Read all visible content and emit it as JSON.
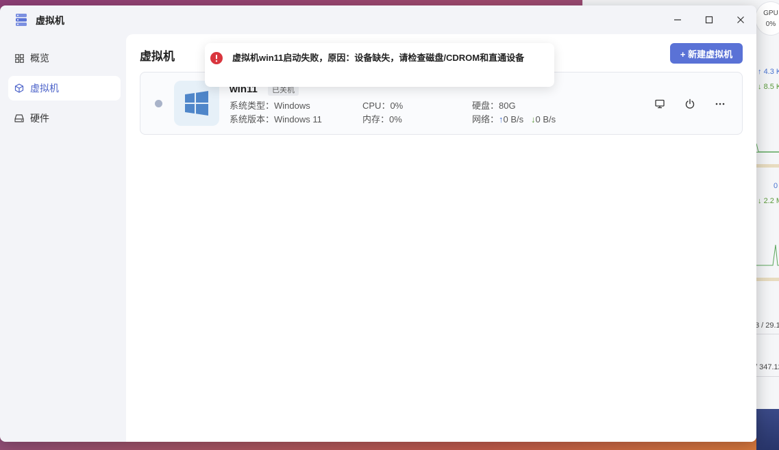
{
  "background_widget": {
    "gpu_label": "GPU",
    "gpu_value": "0%",
    "up_rate": "4.3 K",
    "down_rate": "8.5 K",
    "value_0": "0",
    "rate_2": "2.2 M",
    "mem_partial": "3 / 29.1",
    "disk_partial": "/ 347.12"
  },
  "window": {
    "title": "虚拟机",
    "controls": {
      "minimize": "minimize",
      "maximize": "maximize",
      "close": "close"
    }
  },
  "sidebar": {
    "items": [
      {
        "label": "概览",
        "icon": "grid-icon",
        "active": false
      },
      {
        "label": "虚拟机",
        "icon": "cube-icon",
        "active": true
      },
      {
        "label": "硬件",
        "icon": "drive-icon",
        "active": false
      }
    ]
  },
  "main": {
    "title": "虚拟机",
    "new_button": "+ 新建虚拟机"
  },
  "vm": {
    "name": "win11",
    "state": "已关机",
    "os_type_label": "系统类型：",
    "os_type": "Windows",
    "os_version_label": "系统版本：",
    "os_version": "Windows 11",
    "cpu_label": "CPU：",
    "cpu": "0%",
    "mem_label": "内存：",
    "mem": "0%",
    "disk_label": "硬盘：",
    "disk": "80G",
    "net_label": "网络：",
    "net_up": "0 B/s",
    "net_down": "0 B/s",
    "up_arrow": "↑",
    "down_arrow": "↓"
  },
  "toast": {
    "type": "error",
    "message": "虚拟机win11启动失败，原因：设备缺失，请检查磁盘/CDROM和直通设备"
  },
  "colors": {
    "accent": "#5a72d6",
    "error": "#d9363e",
    "status_off": "#a9b3c9"
  }
}
